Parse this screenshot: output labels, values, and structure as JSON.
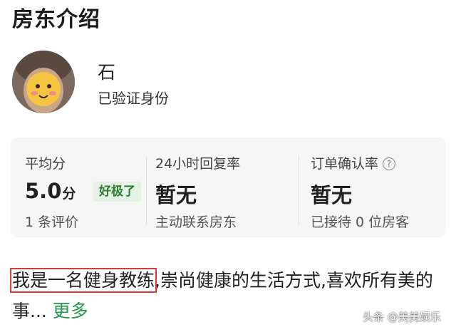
{
  "section": {
    "title": "房东介绍"
  },
  "host": {
    "name": "石",
    "verified_text": "已验证身份"
  },
  "stats": {
    "rating": {
      "label": "平均分",
      "value": "5.0",
      "unit": "分",
      "badge": "好极了",
      "sub": "1 条评价"
    },
    "reply_rate": {
      "label": "24小时回复率",
      "value": "暂无",
      "sub": "主动联系房东"
    },
    "confirm_rate": {
      "label": "订单确认率",
      "help_icon_glyph": "?",
      "value": "暂无",
      "sub": "已接待 0 位房客"
    }
  },
  "intro": {
    "highlight_text": "我是一名健身教练",
    "rest_text": ",崇尚健康的生活方式,喜欢所有美的事...",
    "more_label": "更多"
  },
  "watermark": {
    "text": "头条 @美美娱乐"
  },
  "colors": {
    "badge_bg": "#e5f1e5",
    "badge_text": "#2f7d32",
    "more_link": "#1f9a4a",
    "highlight_border": "#d93a3a",
    "card_bg": "#f6f6f6"
  }
}
